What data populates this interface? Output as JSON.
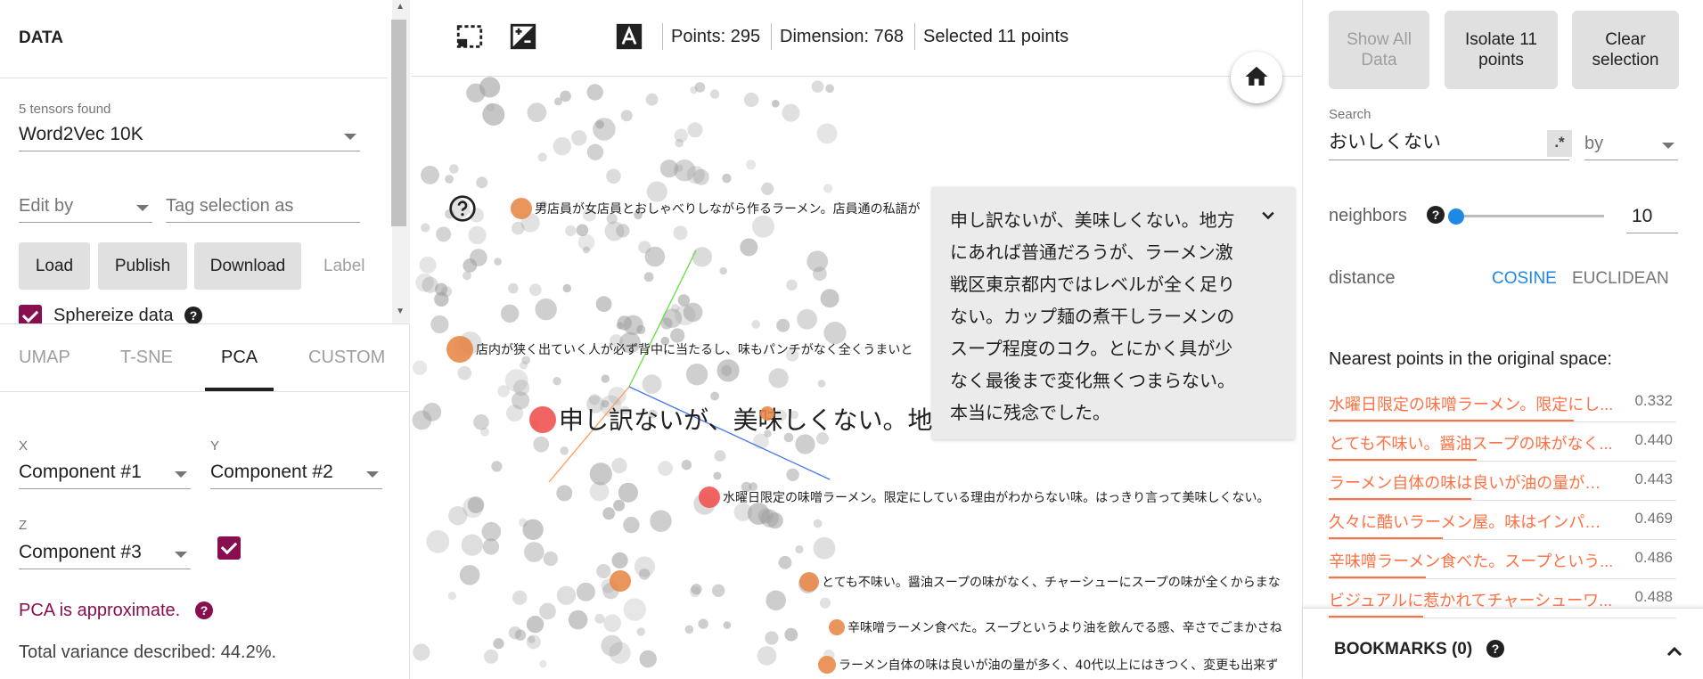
{
  "left": {
    "section_title": "DATA",
    "tensors_found": "5 tensors found",
    "tensor_selected": "Word2Vec 10K",
    "edit_by_placeholder": "Edit by",
    "tag_placeholder": "Tag selection as",
    "buttons": {
      "load": "Load",
      "publish": "Publish",
      "download": "Download",
      "label": "Label"
    },
    "sphereize_label": "Sphereize data",
    "tabs": [
      "UMAP",
      "T-SNE",
      "PCA",
      "CUSTOM"
    ],
    "active_tab": "PCA",
    "pca": {
      "x_label": "X",
      "x_value": "Component #1",
      "y_label": "Y",
      "y_value": "Component #2",
      "z_label": "Z",
      "z_value": "Component #3",
      "approx_text": "PCA is approximate.",
      "variance_text": "Total variance described: 44.2%."
    }
  },
  "toolbar": {
    "points": "Points: 295",
    "dimension": "Dimension: 768",
    "selected": "Selected 11 points"
  },
  "plot": {
    "tooltip_text": "申し訳ないが、美味しくない。地方にあれば普通だろうが、ラーメン激戦区東京都内ではレベルが全く足りない。カップ麺の煮干しラーメンのスープ程度のコク。とにかく具が少なく最後まで変化無くつまらない。本当に残念でした。",
    "labels": [
      "男店員が女店員とおしゃべりしながら作るラーメン。店員通の私語が",
      "店内が狭く出ていく人が必ず背中に当たるし、味もパンチがなく全くうまいと",
      "申し訳ないが、美味しくない。地方にあれば普通だろうが、ラー",
      "水曜日限定の味噌ラーメン。限定にしている理由がわからない味。はっきり言って美味しくない。",
      "とても不味い。醤油スープの味がなく、チャーシューにスープの味が全くからまな",
      "辛味噌ラーメン食べた。スープというより油を飲んでる感、辛さでごまかさね",
      "ラーメン自体の味は良いが油の量が多く、40代以上にはきつく、変更も出来ず"
    ],
    "accent_color": "#ff7043",
    "selected_color": "#ef5350"
  },
  "right": {
    "show_all": "Show All Data",
    "isolate": "Isolate 11 points",
    "clear": "Clear selection",
    "search_label": "Search",
    "search_value": "おいしくない",
    "regex": ".*",
    "by_placeholder": "by",
    "neighbors_label": "neighbors",
    "neighbors_value": "10",
    "distance_label": "distance",
    "distance_options": [
      "COSINE",
      "EUCLIDEAN"
    ],
    "distance_selected": "COSINE",
    "nearest_title": "Nearest points in the original space:",
    "nearest": [
      {
        "text": "水曜日限定の味噌ラーメン。限定にし...",
        "value": "0.332",
        "fill": 0.86
      },
      {
        "text": "とても不味い。醤油スープの味がなく...",
        "value": "0.440",
        "fill": 0.52
      },
      {
        "text": "ラーメン自体の味は良いが油の量が多...",
        "value": "0.443",
        "fill": 0.5
      },
      {
        "text": "久々に酷いラーメン屋。味はインパク...",
        "value": "0.469",
        "fill": 0.4
      },
      {
        "text": "辛味噌ラーメン食べた。スープという...",
        "value": "0.486",
        "fill": 0.34
      },
      {
        "text": "ビジュアルに惹かれてチャーシューワ...",
        "value": "0.488",
        "fill": 0.33
      }
    ],
    "bookmarks": "BOOKMARKS (0)"
  }
}
